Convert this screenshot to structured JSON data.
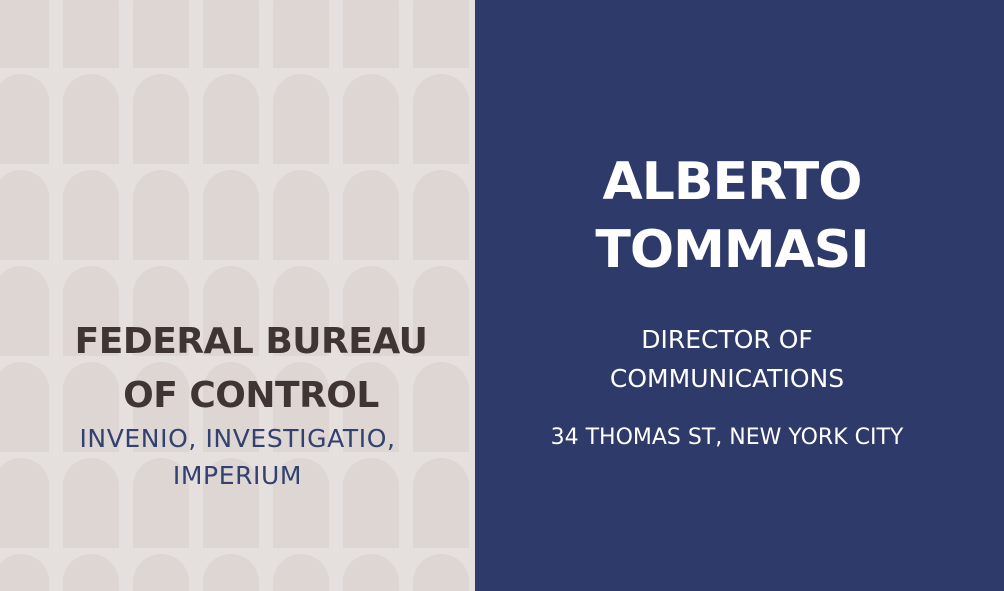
{
  "colors": {
    "left_background": "#e5dfdd",
    "pattern": "#ddd6d3",
    "right_background": "#2e3a6a",
    "org_text": "#3f3533",
    "motto_text": "#33416e",
    "right_text": "#ffffff"
  },
  "organization": {
    "name_line1": "FEDERAL BUREAU",
    "name_line2": "OF CONTROL",
    "motto_line1": "INVENIO, INVESTIGATIO,",
    "motto_line2": "IMPERIUM"
  },
  "person": {
    "first_name": "ALBERTO",
    "last_name": "TOMMASI",
    "title_line1": "DIRECTOR OF",
    "title_line2": "COMMUNICATIONS",
    "address": "34 THOMAS ST, NEW YORK CITY"
  }
}
